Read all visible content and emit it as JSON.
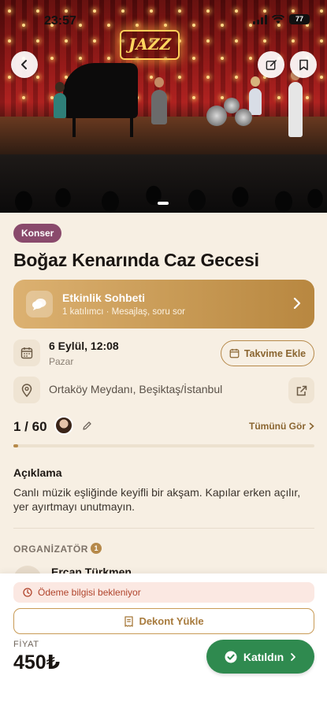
{
  "status_bar": {
    "time": "23:57",
    "battery": "77"
  },
  "event": {
    "category": "Konser",
    "title": "Boğaz Kenarında Caz Gecesi",
    "hero_sign_text": "JAZZ"
  },
  "chat": {
    "title": "Etkinlik Sohbeti",
    "subtitle": "1 katılımcı · Mesajlaş, soru sor"
  },
  "date": {
    "main": "6 Eylül, 12:08",
    "day": "Pazar",
    "calendar_button": "Takvime Ekle"
  },
  "location": {
    "text": "Ortaköy Meydanı, Beşiktaş/İstanbul"
  },
  "participants": {
    "count_text": "1 / 60",
    "current": 1,
    "capacity": 60,
    "see_all": "Tümünü Gör"
  },
  "description": {
    "heading": "Açıklama",
    "text": "Canlı müzik eşliğinde keyifli bir akşam. Kapılar erken açılır, yer ayırtmayı unutmayın."
  },
  "organizer": {
    "heading": "ORGANİZATÖR",
    "badge": "1",
    "name": "Ercan Türkmen"
  },
  "bottom": {
    "payment_notice": "Ödeme bilgisi bekleniyor",
    "receipt_button": "Dekont Yükle",
    "price_label": "FİYAT",
    "price": "450₺",
    "joined_button": "Katıldın"
  },
  "colors": {
    "accent": "#b6894a",
    "category_chip": "#8a4a6c",
    "success": "#2f8a4f",
    "warning_text": "#b0442c",
    "background": "#f7efe3"
  },
  "icons": {
    "back": "chevron-left-icon",
    "edit": "edit-icon",
    "bookmark": "bookmark-icon",
    "chat": "chat-bubble-icon",
    "calendar": "calendar-icon",
    "location": "location-pin-icon",
    "external": "external-link-icon",
    "pencil": "pencil-icon",
    "clock": "clock-icon",
    "receipt": "receipt-icon",
    "check": "check-circle-icon"
  }
}
